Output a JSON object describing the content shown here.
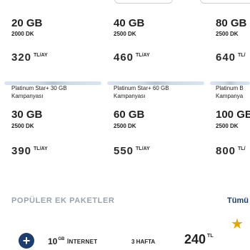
{
  "row1": [
    {
      "gb": "20 GB",
      "minutes": "2000 DK",
      "price": "320",
      "unit": "TL/AY"
    },
    {
      "gb": "40 GB",
      "minutes": "2500 DK",
      "price": "460",
      "unit": "TL/AY"
    },
    {
      "gb": "80 GB",
      "minutes": "2500 DK",
      "price": "640",
      "unit": "TL/"
    }
  ],
  "row2": [
    {
      "name": "Platinum Star+ 30 GB Kampanyası",
      "gb": "30 GB",
      "minutes": "2500 DK",
      "price": "390",
      "unit": "TL/AY"
    },
    {
      "name": "Platinum Star+ 60 GB Kampanyası",
      "gb": "60 GB",
      "minutes": "2500 DK",
      "price": "550",
      "unit": "TL/AY"
    },
    {
      "name": "Platinum B Kampanya",
      "gb": "100 GB",
      "minutes": "2500 DK",
      "price": "800",
      "unit": "TL/"
    }
  ],
  "popular": {
    "title": "POPÜLER EK PAKETLER",
    "see_all": "Tümü",
    "item": {
      "amount": "10",
      "amount_unit": "GB",
      "type": "İNTERNET",
      "duration": "3 HAFTA",
      "price": "240",
      "price_unit": "TL"
    }
  },
  "colors": {
    "accent": "#1c3d6e",
    "star": "#e5a50a",
    "muted": "#9aa3ae"
  },
  "icons": [
    "plus-icon",
    "star-icon"
  ]
}
